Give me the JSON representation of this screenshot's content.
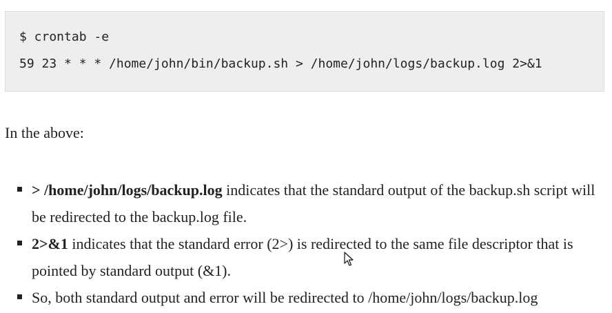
{
  "code": {
    "line1": "$ crontab -e",
    "line2": "59 23 * * * /home/john/bin/backup.sh > /home/john/logs/backup.log 2>&1"
  },
  "intro": "In the above:",
  "bullets": [
    {
      "bold": "> /home/john/logs/backup.log",
      "text": " indicates that the standard output of the backup.sh script will be redirected to the backup.log file."
    },
    {
      "bold": "2>&1",
      "text": " indicates that the standard error (2>) is redirected to the same file descriptor that is pointed by standard output (&1)."
    },
    {
      "bold": "",
      "text": "So, both standard output and error will be redirected to /home/john/logs/backup.log"
    }
  ],
  "icons": {
    "cursor": "mouse-pointer-icon",
    "bullet": "square-bullet-icon"
  }
}
